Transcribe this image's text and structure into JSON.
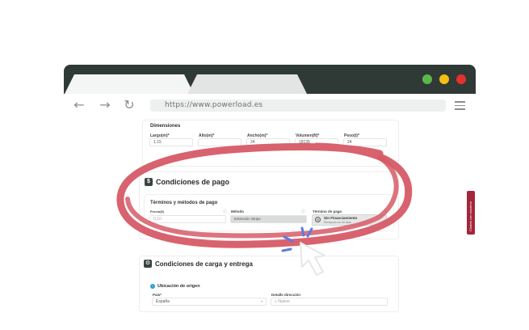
{
  "browser": {
    "url": "https://www.powerload.es"
  },
  "dimensiones": {
    "title": "Dimensiones",
    "fields": [
      {
        "label": "Largo(m)*",
        "value": "1.15"
      },
      {
        "label": "Alto(m)*",
        "value": ""
      },
      {
        "label": "Ancho(m)*",
        "value": "24"
      },
      {
        "label": "Volumen(ft)*",
        "value": "18135"
      },
      {
        "label": "Peso(t)*",
        "value": "24"
      }
    ]
  },
  "pago": {
    "title": "Condiciones de pago",
    "subtitle": "Términos y métodos de pago",
    "precio_label": "Precio(€)",
    "precio_placeholder": "0,10",
    "metodo_label": "Método",
    "metodo_value": "Extensión Stripe",
    "termino_label": "Término de pago",
    "termino_main": "Sin Financiamiento",
    "termino_sub": "Recepción en 30 días"
  },
  "entrega": {
    "title": "Condiciones de carga y entrega",
    "origen_title": "Ubicación de origen",
    "pais_label": "País*",
    "pais_value": "España",
    "detalle_label": "Detalle dirección",
    "detalle_placeholder": "Nuevo"
  },
  "side_tab": {
    "label": "Chatea con nosotros"
  },
  "colors": {
    "chrome": "#2f3a37",
    "highlight": "#d65a66",
    "cursor_spark": "#5a7be0",
    "side_tab": "#a3263a"
  }
}
